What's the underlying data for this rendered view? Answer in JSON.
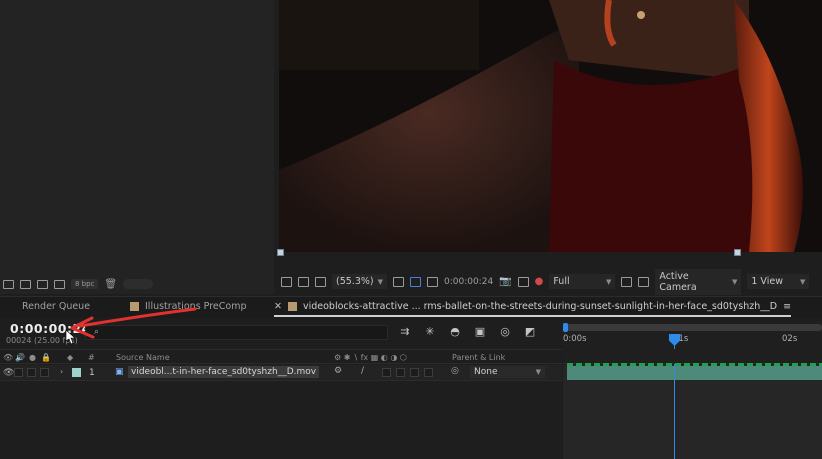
{
  "project_panel": {
    "bpc": "8 bpc"
  },
  "viewer": {
    "zoom": "(55.3%)",
    "timecode": "0:00:00:24",
    "resolution": "Full",
    "camera": "Active Camera",
    "views": "1 View"
  },
  "tabs": [
    {
      "label": "Render Queue"
    },
    {
      "label": "Illustrations PreComp"
    },
    {
      "label": "videoblocks-attractive ... rms-ballet-on-the-streets-during-sunset-sunlight-in-her-face_sd0tyshzh__D"
    }
  ],
  "timeline": {
    "timecode": "0:00:00:24",
    "frames": "00024 (25.00 fps)",
    "search_placeholder": "",
    "ruler_labels": [
      "0:00s",
      "01s",
      "02s"
    ],
    "columns": {
      "hash": "#",
      "source_name": "Source Name",
      "parent_link": "Parent & Link"
    },
    "layers": [
      {
        "number": "1",
        "name": "videobl...t-in-her-face_sd0tyshzh__D.mov",
        "parent": "None",
        "label_color": "#9ed3cd"
      }
    ]
  },
  "colors": {
    "accent": "#2d8ceb",
    "annotation_arrow": "#e0322e",
    "layer_bar": "#4e8a7a"
  }
}
